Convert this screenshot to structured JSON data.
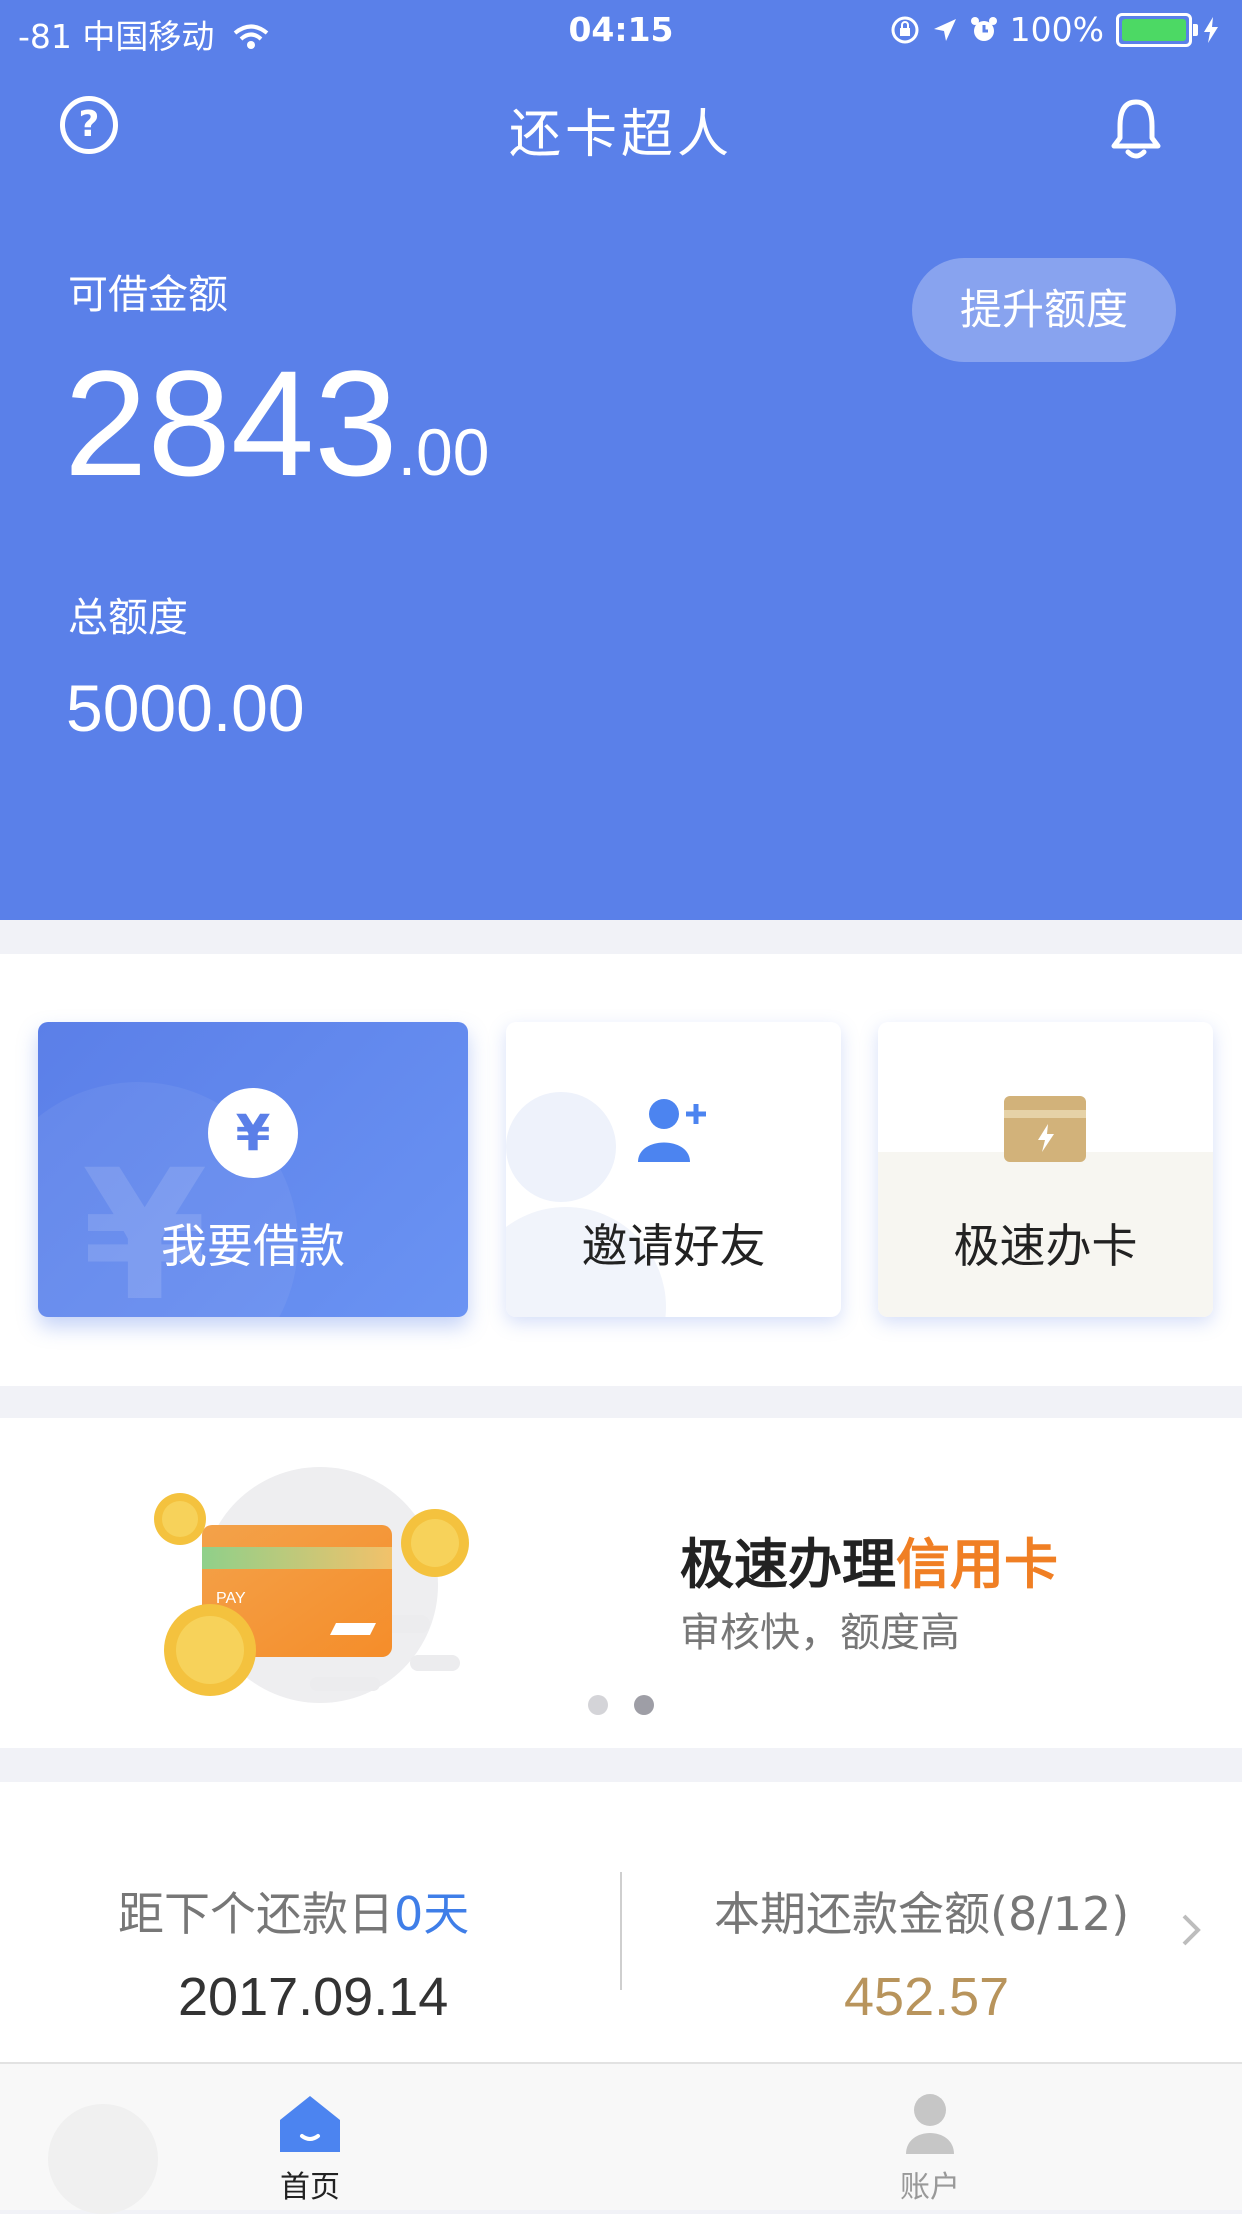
{
  "status_bar": {
    "carrier": "-81 中国移动",
    "time": "04:15",
    "battery": "100%"
  },
  "header": {
    "title": "还卡超人",
    "help_icon": "question-circle-icon",
    "bell_icon": "bell-icon"
  },
  "credit": {
    "available_label": "可借金额",
    "available_int": "2843",
    "available_dec": ".00",
    "raise_button": "提升额度",
    "total_label": "总额度",
    "total_value": "5000.00"
  },
  "quick_actions": [
    {
      "label": "我要借款",
      "icon": "yen-icon"
    },
    {
      "label": "邀请好友",
      "icon": "add-user-icon"
    },
    {
      "label": "极速办卡",
      "icon": "card-icon"
    }
  ],
  "banner": {
    "title_prefix": "极速办理",
    "title_highlight": "信用卡",
    "subtitle": "审核快，额度高",
    "card_text": "PAY",
    "slides": 2,
    "active_slide": 2
  },
  "repayment": {
    "days_label": "距下个还款日",
    "days_value": "0天",
    "date": "2017.09.14",
    "amount_label": "本期还款金额(8/12)",
    "amount": "452.57"
  },
  "tabbar": [
    {
      "label": "首页",
      "icon": "home-icon",
      "active": true
    },
    {
      "label": "账户",
      "icon": "user-icon",
      "active": false
    }
  ],
  "colors": {
    "primary": "#5a80e9",
    "accent_orange": "#f07f24",
    "gold": "#b8945c",
    "link_blue": "#3f7ee8"
  }
}
